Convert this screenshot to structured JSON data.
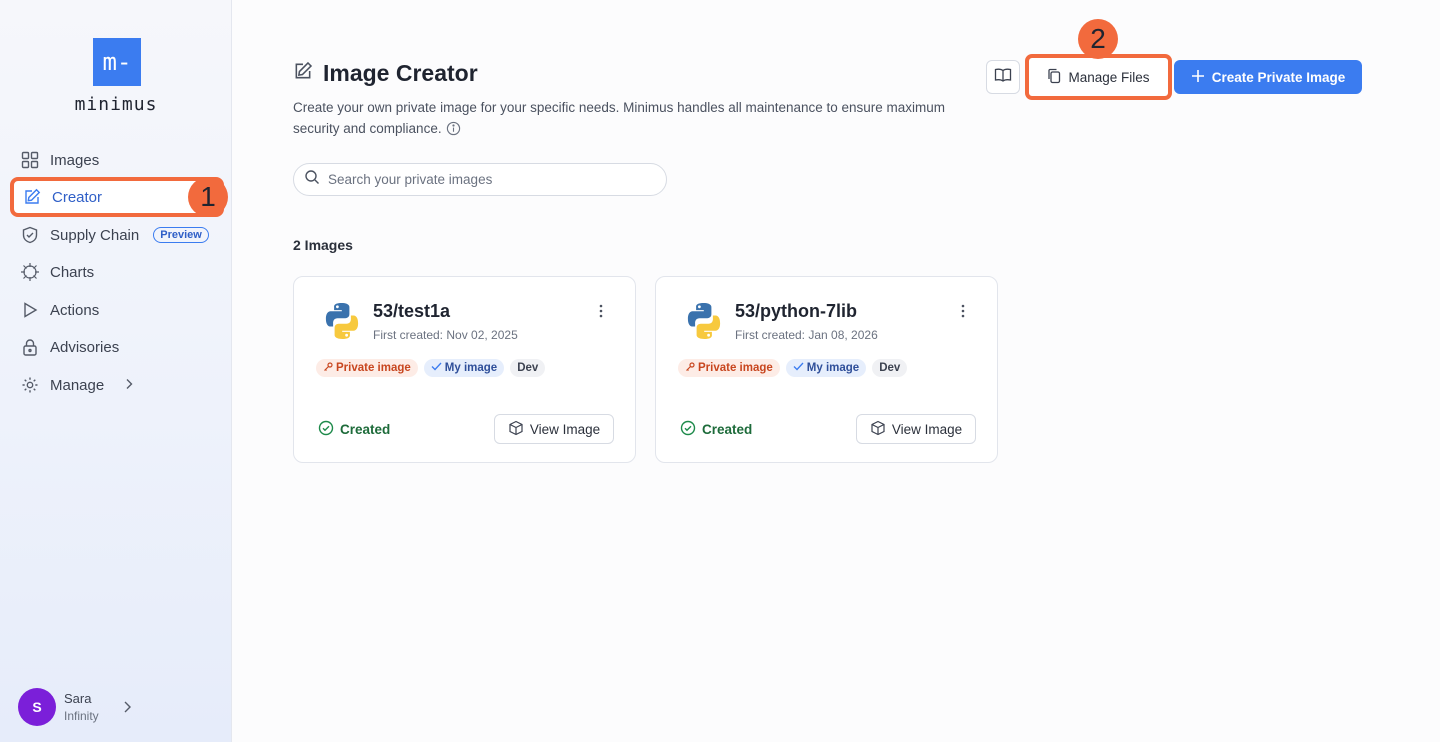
{
  "brand": {
    "logo_mark": "m-",
    "name": "minimus"
  },
  "sidebar": {
    "items": [
      {
        "label": "Images",
        "icon": "grid-icon"
      },
      {
        "label": "Creator",
        "icon": "edit-icon",
        "active": true
      },
      {
        "label": "Supply Chain",
        "icon": "shield-icon",
        "badge": "Preview"
      },
      {
        "label": "Charts",
        "icon": "helm-icon"
      },
      {
        "label": "Actions",
        "icon": "play-icon"
      },
      {
        "label": "Advisories",
        "icon": "lock-icon"
      },
      {
        "label": "Manage",
        "icon": "gear-icon"
      }
    ]
  },
  "user": {
    "initial": "S",
    "name": "Sara",
    "org": "Infinity"
  },
  "markers": {
    "one": "1",
    "two": "2"
  },
  "header": {
    "title": "Image Creator",
    "subtitle": "Create your own private image for your specific needs. Minimus handles all maintenance to ensure maximum security and compliance.",
    "manage_files_label": "Manage Files",
    "create_label": "Create Private Image"
  },
  "search": {
    "placeholder": "Search your private images",
    "value": ""
  },
  "images_count": "2 Images",
  "cards": [
    {
      "name": "53/test1a",
      "created": "First created: Nov 02, 2025",
      "tags": [
        "Private image",
        "My image",
        "Dev"
      ],
      "status": "Created",
      "view_label": "View Image"
    },
    {
      "name": "53/python-7lib",
      "created": "First created: Jan 08, 2026",
      "tags": [
        "Private image",
        "My image",
        "Dev"
      ],
      "status": "Created",
      "view_label": "View Image"
    }
  ],
  "colors": {
    "accent": "#3b7cf0",
    "highlight": "#f26a3d",
    "success": "#1d6b3a",
    "avatar": "#7b1fd9"
  }
}
